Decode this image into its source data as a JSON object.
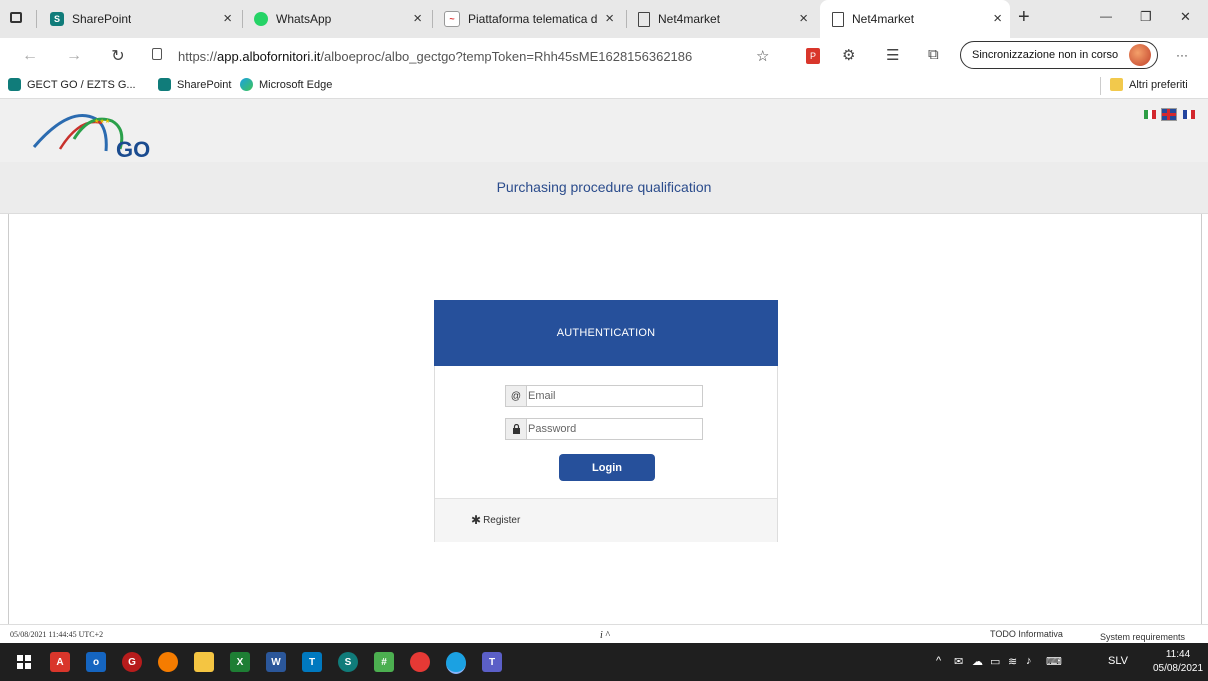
{
  "browser": {
    "tabs": [
      {
        "title": "SharePoint",
        "icon": "sharepoint-icon"
      },
      {
        "title": "WhatsApp",
        "icon": "whatsapp-icon"
      },
      {
        "title": "Piattaforma telematica di",
        "icon": "piattaforma-icon"
      },
      {
        "title": "Net4market",
        "icon": "page-icon"
      },
      {
        "title": "Net4market",
        "icon": "page-icon"
      }
    ],
    "new_tab": "+",
    "url_prefix": "https://",
    "url_domain": "app.albofornitori.it",
    "url_path": "/alboeproc/albo_gectgo?tempToken=Rhh45sME1628156362186",
    "sync_label": "Sincronizzazione non in corso",
    "more": "···",
    "window_controls": {
      "minimize": "—",
      "restore": "❐",
      "close": "✕"
    }
  },
  "favorites": {
    "items": [
      {
        "label": "GECT GO / EZTS G..."
      },
      {
        "label": "SharePoint"
      },
      {
        "label": "Microsoft Edge"
      }
    ],
    "other": "Altri preferiti"
  },
  "page": {
    "logo_text": "GO",
    "title": "Purchasing procedure qualification",
    "languages": [
      "it",
      "en",
      "fr"
    ]
  },
  "auth": {
    "header": "AUTHENTICATION",
    "email_addon": "@",
    "email_placeholder": "Email",
    "password_placeholder": "Password",
    "login_label": "Login",
    "register_label": "Register"
  },
  "footer": {
    "datestamp": "05/08/2021 11:44:45 UTC+2",
    "info": "i ^",
    "todo": "TODO Informativa",
    "sysreq": "System requirements"
  },
  "taskbar": {
    "lang": "SLV",
    "time": "11:44",
    "date": "05/08/2021"
  },
  "colors": {
    "accent": "#26509b",
    "title_blue": "#2b4c8c",
    "taskbar": "#1f1f1f"
  }
}
